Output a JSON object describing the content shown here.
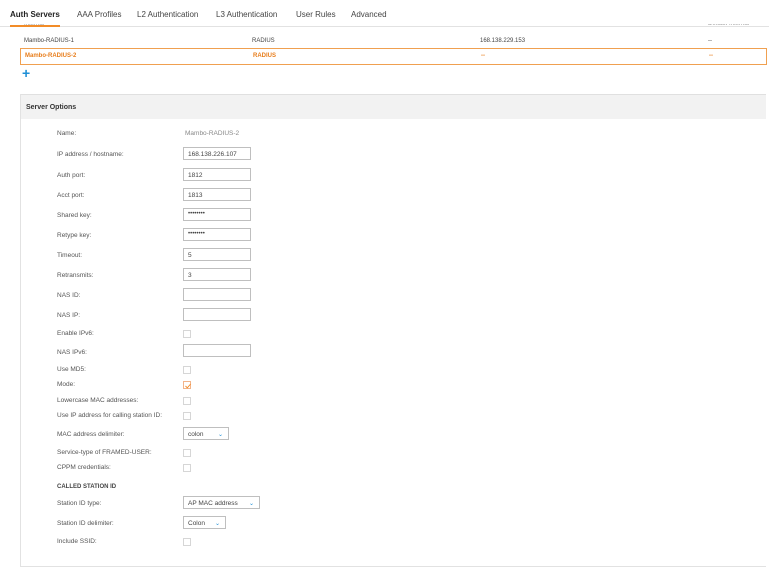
{
  "tabs": [
    {
      "label": "Auth Servers",
      "active": true
    },
    {
      "label": "AAA Profiles"
    },
    {
      "label": "L2 Authentication"
    },
    {
      "label": "L3 Authentication"
    },
    {
      "label": "User Rules"
    },
    {
      "label": "Advanced"
    }
  ],
  "server_table": {
    "header_clipped": [
      "Internal",
      "Default-Internal"
    ],
    "rows": [
      {
        "name": "Mambo-RADIUS-1",
        "type": "RADIUS",
        "ip": "168.138.229.153",
        "extra": "--"
      },
      {
        "name": "Mambo-RADIUS-2",
        "type": "RADIUS",
        "ip": "--",
        "extra": "--",
        "selected": true
      }
    ],
    "add_icon": "+"
  },
  "server_options": {
    "title": "Server Options",
    "name_label": "Name:",
    "name_value": "Mambo-RADIUS-2",
    "ip_label": "IP address / hostname:",
    "ip_value": "168.138.226.107",
    "auth_port_label": "Auth port:",
    "auth_port_value": "1812",
    "acct_port_label": "Acct port:",
    "acct_port_value": "1813",
    "shared_key_label": "Shared key:",
    "shared_key_value": "••••••••",
    "retype_key_label": "Retype key:",
    "retype_key_value": "••••••••",
    "timeout_label": "Timeout:",
    "timeout_value": "5",
    "retransmits_label": "Retransmits:",
    "retransmits_value": "3",
    "nas_id_label": "NAS ID:",
    "nas_id_value": "",
    "nas_ip_label": "NAS IP:",
    "nas_ip_value": "",
    "enable_ipv6_label": "Enable IPv6:",
    "enable_ipv6_checked": false,
    "nas_ipv6_label": "NAS IPv6:",
    "nas_ipv6_value": "",
    "use_md5_label": "Use MD5:",
    "use_md5_checked": false,
    "mode_label": "Mode:",
    "mode_checked": true,
    "lowercase_mac_label": "Lowercase MAC addresses:",
    "lowercase_mac_checked": false,
    "use_ip_calling_label": "Use IP address for calling station ID:",
    "use_ip_calling_checked": false,
    "mac_delim_label": "MAC address delimiter:",
    "mac_delim_value": "colon",
    "service_type_label": "Service-type of FRAMED-USER:",
    "service_type_checked": false,
    "cppm_label": "CPPM credentials:",
    "cppm_checked": false,
    "called_station_title": "CALLED STATION ID",
    "station_id_type_label": "Station ID type:",
    "station_id_type_value": "AP MAC address",
    "station_id_delim_label": "Station ID delimiter:",
    "station_id_delim_value": "Colon",
    "include_ssid_label": "Include SSID:",
    "include_ssid_checked": false
  },
  "colors": {
    "accent": "#f28c28",
    "link": "#1f8fd6",
    "selected_row_border": "#f0a050"
  }
}
